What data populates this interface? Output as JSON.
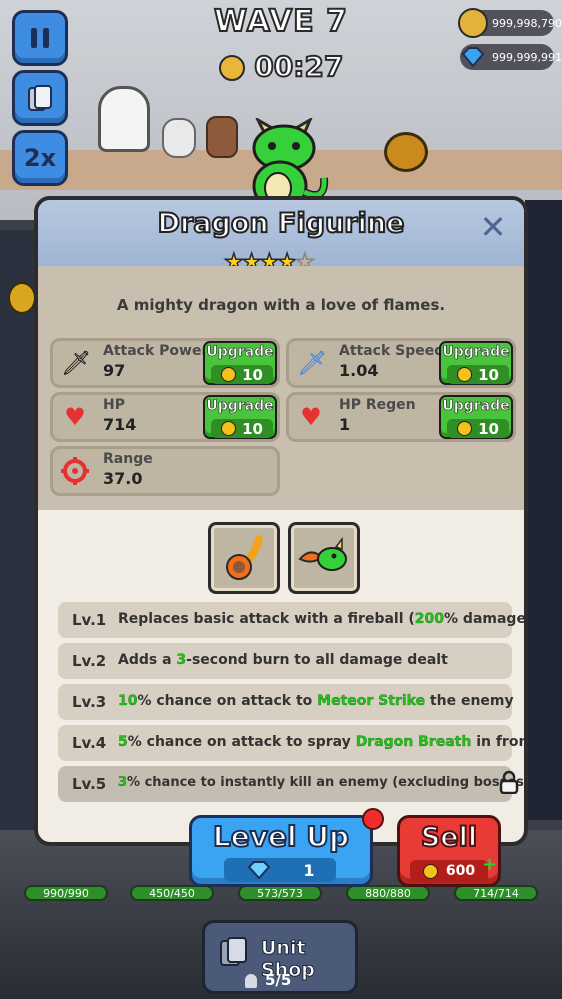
{
  "hud": {
    "wave": "WAVE 7",
    "timer": "00:27",
    "gold": "999,998,790",
    "gems": "999,999,991",
    "speed_label": "2x"
  },
  "dialog": {
    "title": "Dragon Figurine",
    "stars_filled": 4,
    "stars_total": 5,
    "description": "A mighty dragon with a love of flames.",
    "stats": [
      {
        "label": "Attack Power",
        "value": "97",
        "upgrade_label": "Upgrade",
        "cost": "10",
        "icon": "sword-icon"
      },
      {
        "label": "Attack Speed",
        "value": "1.04",
        "upgrade_label": "Upgrade",
        "cost": "10",
        "icon": "blue-sword-icon"
      },
      {
        "label": "HP",
        "value": "714",
        "upgrade_label": "Upgrade",
        "cost": "10",
        "icon": "heart-icon"
      },
      {
        "label": "HP Regen",
        "value": "1",
        "upgrade_label": "Upgrade",
        "cost": "10",
        "icon": "heart-icon"
      },
      {
        "label": "Range",
        "value": "37.0",
        "icon": "crosshair-icon"
      }
    ],
    "skills": [
      "fireball-skill-icon",
      "dragon-breath-skill-icon"
    ],
    "levels": [
      {
        "lv": "Lv.1",
        "parts": [
          "Replaces basic attack with a fireball (",
          "200",
          "% damage)"
        ]
      },
      {
        "lv": "Lv.2",
        "parts": [
          "Adds a ",
          "3",
          "-second burn to all damage dealt"
        ]
      },
      {
        "lv": "Lv.3",
        "parts": [
          "10",
          "% chance on attack to ",
          "Meteor Strike",
          " the enemy"
        ]
      },
      {
        "lv": "Lv.4",
        "parts": [
          "5",
          "% chance on attack to spray ",
          "Dragon Breath",
          " in front"
        ]
      },
      {
        "lv": "Lv.5",
        "parts": [
          "3",
          "% chance to instantly kill an enemy (excluding bosses)"
        ]
      }
    ]
  },
  "actions": {
    "level_up_label": "Level Up",
    "level_up_cost": "1",
    "sell_label": "Sell",
    "sell_value": "600"
  },
  "unit_hp": [
    "990/990",
    "450/450",
    "573/573",
    "880/880",
    "714/714"
  ],
  "shop": {
    "label": "Unit Shop",
    "count": "5/5"
  },
  "colors": {
    "accent_green": "#22c21a",
    "upgrade_green": "#49c43c",
    "levelup_blue": "#3aa4f2",
    "sell_red": "#e83b36"
  }
}
